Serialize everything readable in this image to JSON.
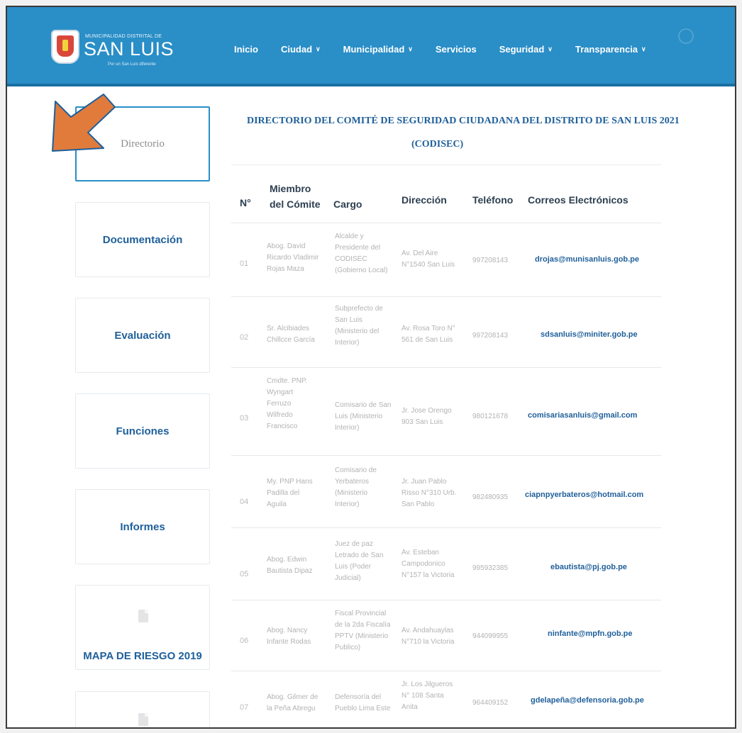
{
  "brand": {
    "small_text": "MUNICIPALIDAD DISTRITAL DE",
    "name": "SAN LUIS",
    "tagline": "Por un San Luis diferente"
  },
  "nav": [
    {
      "label": "Inicio",
      "has_dropdown": false
    },
    {
      "label": "Ciudad",
      "has_dropdown": true
    },
    {
      "label": "Municipalidad",
      "has_dropdown": true
    },
    {
      "label": "Servicios",
      "has_dropdown": false
    },
    {
      "label": "Seguridad",
      "has_dropdown": true
    },
    {
      "label": "Transparencia",
      "has_dropdown": true
    }
  ],
  "sidebar": {
    "items": [
      {
        "label": "Directorio",
        "active": true
      },
      {
        "label": "Documentación"
      },
      {
        "label": "Evaluación"
      },
      {
        "label": "Funciones"
      },
      {
        "label": "Informes"
      },
      {
        "label": "MAPA DE RIESGO 2019"
      }
    ]
  },
  "content": {
    "title_line1": "DIRECTORIO DEL COMITÉ DE SEGURIDAD CIUDADANA DEL DISTRITO DE SAN LUIS 2021",
    "title_line2": "(CODISEC)",
    "headers": {
      "num": "N°",
      "member": [
        "Miembro",
        "del Cómite"
      ],
      "cargo": "Cargo",
      "direccion": "Dirección",
      "telefono": "Teléfono",
      "correos": "Correos Electrónicos"
    },
    "rows": [
      {
        "num": "01",
        "member": [
          "Abog. David",
          "Ricardo Vladimir",
          "Rojas Maza"
        ],
        "cargo": [
          "Alcalde y",
          "Presidente del",
          "CODISEC",
          "(Gobierno Local)"
        ],
        "direccion": [
          "Av. Del Aire",
          "N°1540 San Luis"
        ],
        "telefono": "997208143",
        "email": "drojas@munisanluis.gob.pe"
      },
      {
        "num": "02",
        "member": [
          "Sr. Alcibiades",
          "Chillcce García"
        ],
        "cargo": [
          "Subprefecto de",
          "San Luis",
          "(Ministerio del",
          "Interior)"
        ],
        "direccion": [
          "Av. Rosa Toro N°",
          "561 de San Luis"
        ],
        "telefono": "997208143",
        "email": "sdsanluis@miniter.gob.pe"
      },
      {
        "num": "03",
        "member": [
          "Cmdte. PNP.",
          "Wyngart",
          "Ferruzo",
          "Wilfredo",
          "Francisco"
        ],
        "cargo": [
          "Comisario de San",
          "Luis (Ministerio",
          "Interior)"
        ],
        "direccion": [
          "Jr. Jose Orengo",
          "903 San Luis"
        ],
        "telefono": "980121678",
        "email": "comisariasanluis@gmail.com"
      },
      {
        "num": "04",
        "member": [
          "My. PNP Hans",
          "Padilla del",
          "Aguila"
        ],
        "cargo": [
          "Comisario de",
          "Yerbateros",
          "(Ministerio",
          "Interior)"
        ],
        "direccion": [
          "Jr. Juan Pablo",
          "Risso N°310 Urb.",
          "San Pablo"
        ],
        "telefono": "982480935",
        "email": "ciapnpyerbateros@hotmail.com"
      },
      {
        "num": "05",
        "member": [
          "Abog. Edwin",
          "Bautista Dipaz"
        ],
        "cargo": [
          "Juez de paz",
          "Letrado de San",
          "Luis   (Poder",
          "Judicial)"
        ],
        "direccion": [
          "Av. Esteban",
          "Campodonico",
          "N°157 la Victoria"
        ],
        "telefono": "995932385",
        "email": "ebautista@pj.gob.pe"
      },
      {
        "num": "06",
        "member": [
          "Abog. Nancy",
          "Infante Rodas"
        ],
        "cargo": [
          "Fiscal Provincial",
          "de la 2da Fiscalía",
          "PPTV (Ministerio",
          "Publico)"
        ],
        "direccion": [
          "Av. Andahuaylas",
          "N°710 la Victoria"
        ],
        "telefono": "944099955",
        "email": "ninfante@mpfn.gob.pe"
      },
      {
        "num": "07",
        "member": [
          "Abog. Gilmer de",
          "la Peña Abregu"
        ],
        "cargo": [
          "Defensoría del",
          "Pueblo Lima Este"
        ],
        "direccion": [
          "Jr. Los Jilgueros",
          "N° 108 Santa",
          "Anita"
        ],
        "telefono": "964409152",
        "email": "gdelapeña@defensoria.gob.pe"
      }
    ]
  },
  "colors": {
    "header_bg": "#2a8ec7",
    "link_blue": "#1f5f9a",
    "arrow": "#e07b3c"
  }
}
